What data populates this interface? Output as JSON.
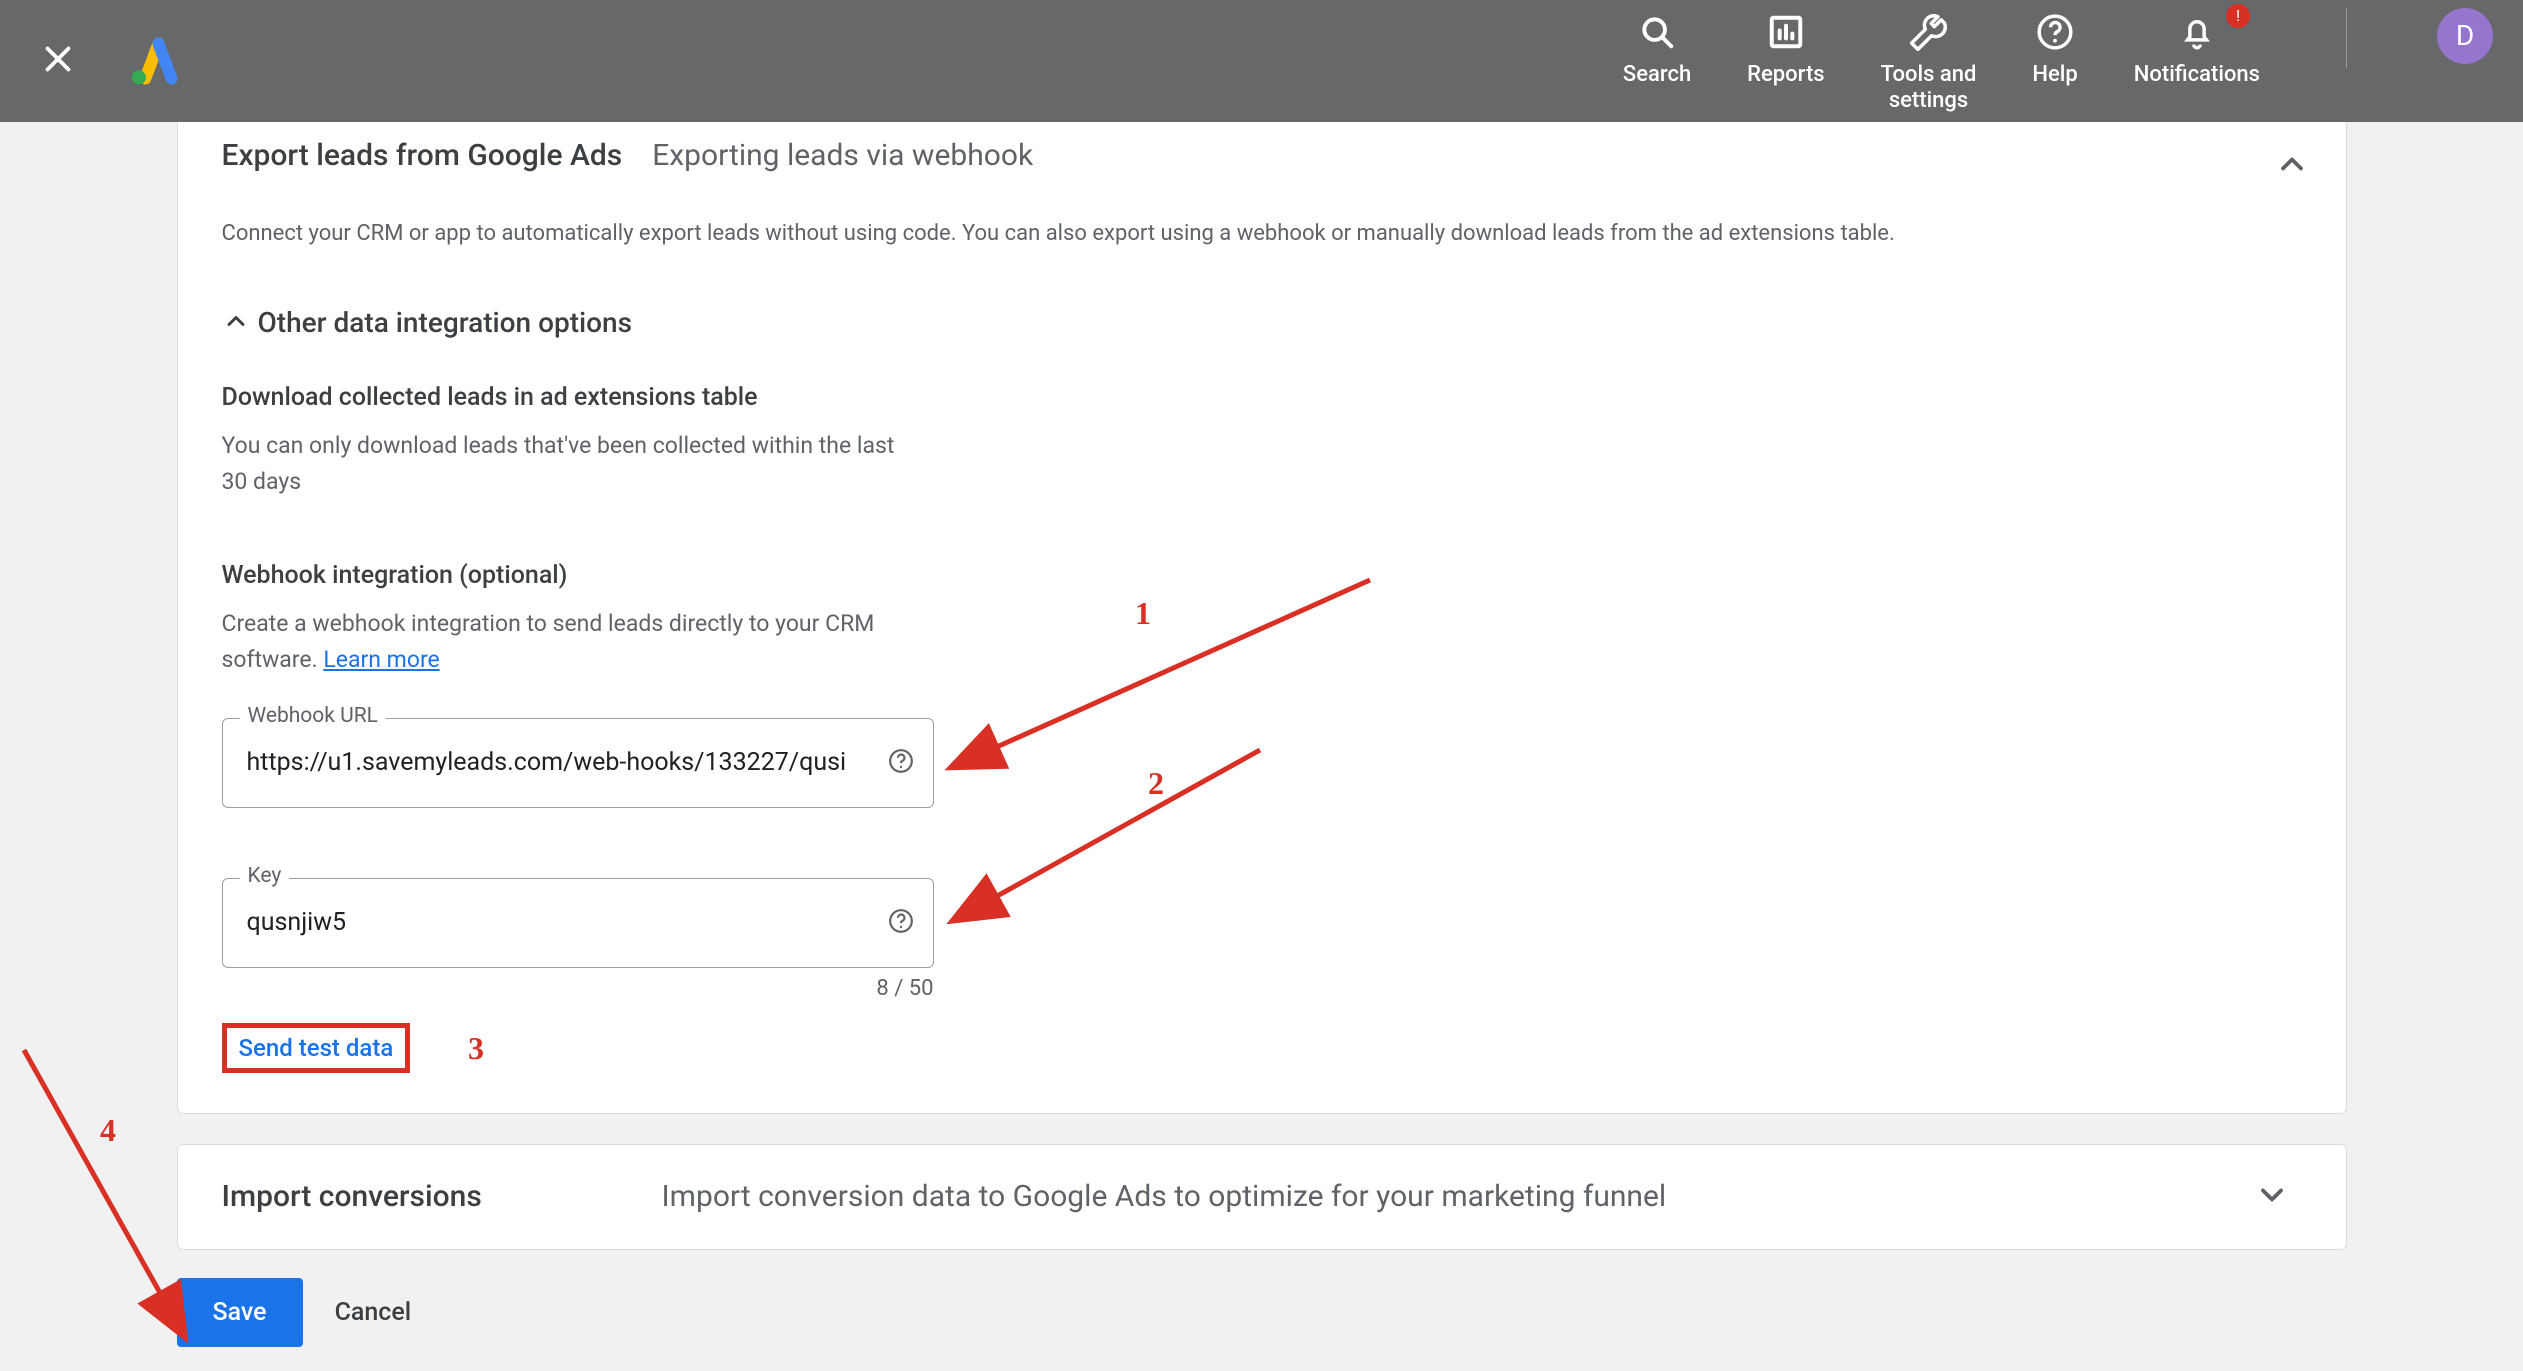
{
  "topbar": {
    "nav": {
      "search": "Search",
      "reports": "Reports",
      "tools": "Tools and\nsettings",
      "help": "Help",
      "notifications": "Notifications"
    },
    "avatar_letter": "D",
    "notif_badge": "!"
  },
  "card": {
    "title": "Export leads from Google Ads",
    "subtitle": "Exporting leads via webhook",
    "intro": "Connect your CRM or app to automatically export leads without using code. You can also export using a webhook or manually download leads from the ad extensions table.",
    "other_options": "Other data integration options",
    "download_h": "Download collected leads in ad extensions table",
    "download_p": "You can only download leads that've been collected within the last 30 days",
    "webhook_h": "Webhook integration (optional)",
    "webhook_p_pre": "Create a webhook integration to send leads directly to your CRM software. ",
    "learn_more": "Learn more",
    "url_label": "Webhook URL",
    "url_value": "https://u1.savemyleads.com/web-hooks/133227/qusi",
    "key_label": "Key",
    "key_value": "qusnjiw5",
    "key_counter": "8 / 50",
    "send_test": "Send test data"
  },
  "import": {
    "title": "Import conversions",
    "desc": "Import conversion data to Google Ads to optimize for your marketing funnel"
  },
  "footer": {
    "save": "Save",
    "cancel": "Cancel"
  },
  "annotations": {
    "n1": "1",
    "n2": "2",
    "n3": "3",
    "n4": "4"
  }
}
